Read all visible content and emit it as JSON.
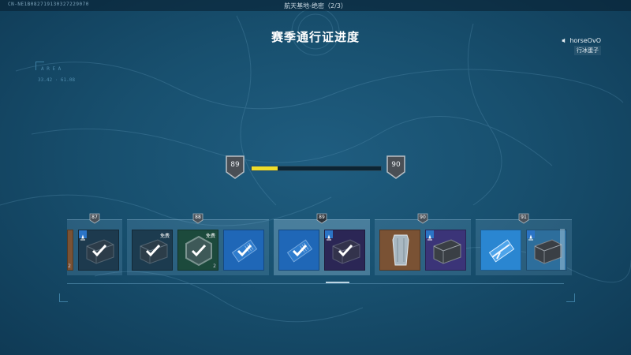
{
  "header": {
    "build": "CN-NE1B082719130327229070",
    "map_title": "航天基地-绝密（2/3）",
    "page_title": "赛季通行证进度"
  },
  "user": {
    "name": "horseOvO",
    "sub": "行冰蛋子"
  },
  "deco": {
    "left_label": "A R E A",
    "coord": "33.42 · 61.08"
  },
  "progress": {
    "current_level": "89",
    "next_level": "90",
    "fraction": 0.2,
    "fill_color": "#f0de2a"
  },
  "rewards": {
    "groups": [
      {
        "level": "87",
        "cards": [
          {
            "bg": "#1d3a4e",
            "icon": "case-icon",
            "claimed": true,
            "premium": true
          }
        ]
      },
      {
        "level": "88",
        "cards": [
          {
            "bg": "#1c3b4f",
            "icon": "case-icon",
            "claimed": true,
            "premium": false,
            "free_label": "免费"
          },
          {
            "bg": "#1c4a3c",
            "icon": "hex-badge-icon",
            "claimed": true,
            "premium": false,
            "free_label": "免费",
            "count": "2"
          },
          {
            "bg": "#1f67b7",
            "icon": "ticket-icon",
            "claimed": true,
            "premium": false
          }
        ]
      },
      {
        "level": "89",
        "current": true,
        "cards": [
          {
            "bg": "#1f67b7",
            "icon": "ticket-icon",
            "claimed": true,
            "premium": false
          },
          {
            "bg": "#2b2655",
            "icon": "case-icon",
            "claimed": true,
            "premium": true
          }
        ]
      },
      {
        "level": "90",
        "cards": [
          {
            "bg": "#7a5234",
            "icon": "armor-plate-icon",
            "claimed": false,
            "premium": false
          },
          {
            "bg": "#3b3478",
            "icon": "case-icon",
            "claimed": false,
            "premium": true
          }
        ]
      },
      {
        "level": "91",
        "cards": [
          {
            "bg": "#2a86d1",
            "icon": "weapon-ticket-icon",
            "claimed": false,
            "premium": false
          },
          {
            "bg": "#2d6e9c",
            "icon": "case-icon",
            "claimed": false,
            "premium": true
          }
        ]
      }
    ],
    "partial_left_count": "2"
  }
}
